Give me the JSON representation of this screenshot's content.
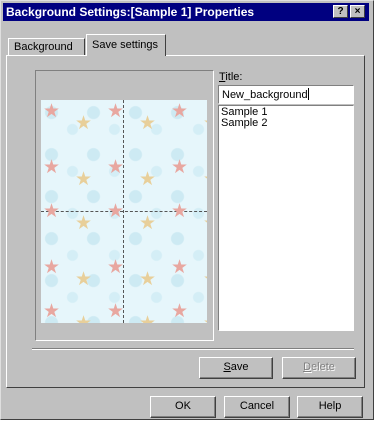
{
  "window": {
    "title": "Background Settings:[Sample 1] Properties"
  },
  "titlebar_buttons": {
    "help": "?",
    "close": "×"
  },
  "tabs": [
    {
      "label": "Background",
      "active": false
    },
    {
      "label": "Save settings",
      "active": true
    }
  ],
  "form": {
    "title_label_mnemonic": "T",
    "title_label_rest": "itle:",
    "title_value": "New_background"
  },
  "saved_list": [
    "Sample 1",
    "Sample 2"
  ],
  "buttons": {
    "save_mnemonic": "S",
    "save_rest": "ave",
    "delete_mnemonic": "D",
    "delete_rest": "elete",
    "ok": "OK",
    "cancel": "Cancel",
    "help": "Help"
  },
  "icons": {
    "star": "★"
  },
  "colors": {
    "titlebar": "#000080",
    "face": "#c0c0c0",
    "preview_bg": "#e6f6fb",
    "star_pink": "#e8a7a0",
    "star_tan": "#e8cf9a"
  }
}
